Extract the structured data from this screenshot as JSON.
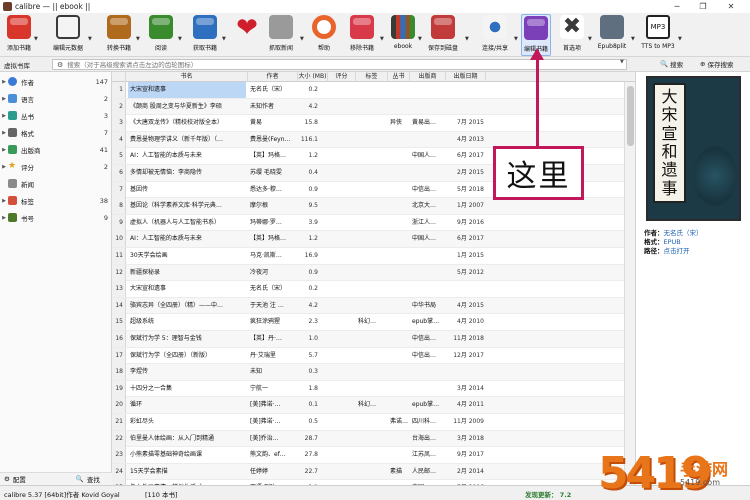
{
  "window": {
    "title": "calibre — || ebook ||",
    "controls": [
      "─",
      "❐",
      "✕"
    ]
  },
  "toolbar": {
    "buttons": [
      {
        "label": "添加书籍",
        "icon": "add-books-icon",
        "color": "#d9362b"
      },
      {
        "label": "编辑元数据",
        "icon": "edit-metadata-icon",
        "color": "#3a3a3a"
      },
      {
        "label": "转换书籍",
        "icon": "convert-books-icon",
        "color": "#b06a1e"
      },
      {
        "label": "阅读",
        "icon": "read-book-icon",
        "color": "#3a8a2e"
      },
      {
        "label": "获取书籍",
        "icon": "get-books-icon",
        "color": "#2f6fbf"
      },
      {
        "label": "",
        "icon": "heart-icon",
        "color": "#cf1f2c"
      },
      {
        "label": "抓取新闻",
        "icon": "fetch-news-icon",
        "color": "#7a7a7a"
      },
      {
        "label": "帮助",
        "icon": "help-icon",
        "color": "#e8642c"
      },
      {
        "label": "移除书籍",
        "icon": "remove-books-icon",
        "color": "#d93a4a"
      },
      {
        "label": "ebook",
        "icon": "library-icon",
        "color": "#8a5a2a"
      },
      {
        "label": "保存到磁盘",
        "icon": "save-to-disk-icon",
        "color": "#c23b3b"
      },
      {
        "label": "连接/共享",
        "icon": "connect-share-icon",
        "color": "#2f6fbf"
      },
      {
        "label": "编辑书籍",
        "icon": "edit-book-icon",
        "color": "#7b3fb8"
      },
      {
        "label": "首选项",
        "icon": "preferences-icon",
        "color": "#3a3a3a"
      },
      {
        "label": "Epub8plit",
        "icon": "epub-split-icon",
        "color": "#5f6f80"
      },
      {
        "label": "TTS to MP3",
        "icon": "tts-mp3-icon",
        "color": "#222222"
      }
    ]
  },
  "searchbar": {
    "virtual_library": "虚拟书库",
    "placeholder": "搜索（对于高级搜索请点击左边的齿轮图标）",
    "search_label": "搜索",
    "save_search_label": "保存搜索"
  },
  "sidebar": {
    "items": [
      {
        "label": "作者",
        "count": "147",
        "color": "#3a7bd5"
      },
      {
        "label": "语言",
        "count": "2",
        "color": "#4a8fd8"
      },
      {
        "label": "丛书",
        "count": "3",
        "color": "#2a9d8f"
      },
      {
        "label": "格式",
        "count": "7",
        "color": "#666666"
      },
      {
        "label": "出版商",
        "count": "41",
        "color": "#3a9a5a"
      },
      {
        "label": "评分",
        "count": "2",
        "color": "#e0a21b"
      },
      {
        "label": "新闻",
        "count": "",
        "color": "#7a7a7a"
      },
      {
        "label": "标签",
        "count": "38",
        "color": "#d4503a"
      },
      {
        "label": "书号",
        "count": "9",
        "color": "#4d7a2a"
      }
    ],
    "configure_label": "配置",
    "find_label": "查找"
  },
  "table": {
    "columns": [
      "书名",
      "作者",
      "大小 (MB)",
      "评分",
      "标签",
      "丛书",
      "出版商",
      "出版日期"
    ],
    "rows": [
      {
        "n": "1",
        "title": "大宋宣和遗事",
        "author": "无名氏（宋）",
        "size": "0.2",
        "tags": "",
        "series": "",
        "publisher": "",
        "date": ""
      },
      {
        "n": "2",
        "title": "《颠商 股周之变与华夏新生》李硕",
        "author": "未知作者",
        "size": "4.2",
        "tags": "",
        "series": "",
        "publisher": "",
        "date": ""
      },
      {
        "n": "3",
        "title": "《大唐双龙传》（精校校对版全本）",
        "author": "黄易",
        "size": "15.8",
        "tags": "",
        "series": "异侠",
        "publisher": "黄易出…",
        "date": "7月 2015"
      },
      {
        "n": "4",
        "title": "费恩曼物理学讲义（新千年版）（…",
        "author": "费恩曼(Feyn…",
        "size": "116.1",
        "tags": "",
        "series": "",
        "publisher": "",
        "date": "4月 2013"
      },
      {
        "n": "5",
        "title": "AI：人工智能的本质与未来",
        "author": "【英】玛格…",
        "size": "1.2",
        "tags": "",
        "series": "",
        "publisher": "中国人…",
        "date": "6月 2017"
      },
      {
        "n": "6",
        "title": "多情却被无情恼：李商隐传",
        "author": "苏缨 毛晓雯",
        "size": "0.4",
        "tags": "",
        "series": "",
        "publisher": "",
        "date": "2月 2015"
      },
      {
        "n": "7",
        "title": "基因传",
        "author": "悉达多·穆…",
        "size": "0.9",
        "tags": "",
        "series": "",
        "publisher": "中信出…",
        "date": "5月 2018"
      },
      {
        "n": "8",
        "title": "基因论（科学素养文库·科学元典…",
        "author": "摩尔根",
        "size": "9.5",
        "tags": "",
        "series": "",
        "publisher": "北京大…",
        "date": "1月 2007"
      },
      {
        "n": "9",
        "title": "虚拟人（机器人与人工智能书系）",
        "author": "玛蒂娜·罗…",
        "size": "3.9",
        "tags": "",
        "series": "",
        "publisher": "浙江人…",
        "date": "9月 2016"
      },
      {
        "n": "10",
        "title": "AI：人工智能的本质与未来",
        "author": "【英】玛格…",
        "size": "1.2",
        "tags": "",
        "series": "",
        "publisher": "中国人…",
        "date": "6月 2017"
      },
      {
        "n": "11",
        "title": "30天学会绘画",
        "author": "马克·凯斯…",
        "size": "16.9",
        "tags": "",
        "series": "",
        "publisher": "",
        "date": "1月 2015"
      },
      {
        "n": "12",
        "title": "新疆探秘录",
        "author": "冷夜河",
        "size": "0.9",
        "tags": "",
        "series": "",
        "publisher": "",
        "date": "5月 2012"
      },
      {
        "n": "13",
        "title": "大宋宣和遗事",
        "author": "无名氏（宋）",
        "size": "0.2",
        "tags": "",
        "series": "",
        "publisher": "",
        "date": ""
      },
      {
        "n": "14",
        "title": "骆宾志异（全四册）（精）——中…",
        "author": "于天池 注 …",
        "size": "4.2",
        "tags": "",
        "series": "",
        "publisher": "中华书局",
        "date": "4月 2015"
      },
      {
        "n": "15",
        "title": "超级系统",
        "author": "疯狂涂鸦猩",
        "size": "2.3",
        "tags": "科幻…",
        "series": "",
        "publisher": "epub掌…",
        "date": "4月 2010"
      },
      {
        "n": "16",
        "title": "保斌行为学 5：理智与金钱",
        "author": "【英】丹·…",
        "size": "1.0",
        "tags": "",
        "series": "",
        "publisher": "中信出…",
        "date": "11月 2018"
      },
      {
        "n": "17",
        "title": "保斌行为学（全四册）（新版）",
        "author": "丹·艾瑞里",
        "size": "5.7",
        "tags": "",
        "series": "",
        "publisher": "中信出…",
        "date": "12月 2017"
      },
      {
        "n": "18",
        "title": "李煜传",
        "author": "未知",
        "size": "0.3",
        "tags": "",
        "series": "",
        "publisher": "",
        "date": ""
      },
      {
        "n": "19",
        "title": "十四分之一合集",
        "author": "宁航一",
        "size": "1.8",
        "tags": "",
        "series": "",
        "publisher": "",
        "date": "3月 2014"
      },
      {
        "n": "20",
        "title": "循环",
        "author": "[美]弗诺·…",
        "size": "0.1",
        "tags": "科幻…",
        "series": "",
        "publisher": "epub掌…",
        "date": "4月 2011"
      },
      {
        "n": "21",
        "title": "彩虹尽头",
        "author": "[美]弗诺·…",
        "size": "0.5",
        "tags": "",
        "series": "弗诺…",
        "publisher": "四川科…",
        "date": "11月 2009"
      },
      {
        "n": "22",
        "title": "伯里曼人体绘画：从入门到精通",
        "author": "[美]乔治…",
        "size": "28.7",
        "tags": "",
        "series": "",
        "publisher": "台海出…",
        "date": "3月 2018"
      },
      {
        "n": "23",
        "title": "小熊素描零基础神奇绘画课",
        "author": "熊文韵、ef…",
        "size": "27.8",
        "tags": "",
        "series": "",
        "publisher": "江苏凤…",
        "date": "9月 2017"
      },
      {
        "n": "24",
        "title": "15天学会素描",
        "author": "任婷婷",
        "size": "22.7",
        "tags": "",
        "series": "素描",
        "publisher": "人民邮…",
        "date": "2月 2014"
      },
      {
        "n": "25",
        "title": "像上外运事情一样地生活 人…",
        "author": "百语 到叶…",
        "size": "1.1",
        "tags": "",
        "series": "",
        "publisher": "中国…",
        "date": "7月 2016"
      }
    ]
  },
  "details": {
    "cover_chars": [
      "大",
      "宋",
      "宣",
      "和",
      "遗",
      "事"
    ],
    "author_label": "作者：",
    "author_value": "无名氏（宋）",
    "format_label": "格式：",
    "format_value": "EPUB",
    "path_label": "路径：",
    "path_value": "点击打开"
  },
  "statusbar": {
    "left": "calibre 5.37 [64bit]作者 Kovid Goyal",
    "middle": "[110 本书]",
    "right": "发现更新： 7.2"
  },
  "annotation": {
    "text": "这里",
    "color": "#c2185b"
  },
  "watermark": {
    "number": "5419",
    "site": "手游网",
    "url": "5419.com"
  }
}
